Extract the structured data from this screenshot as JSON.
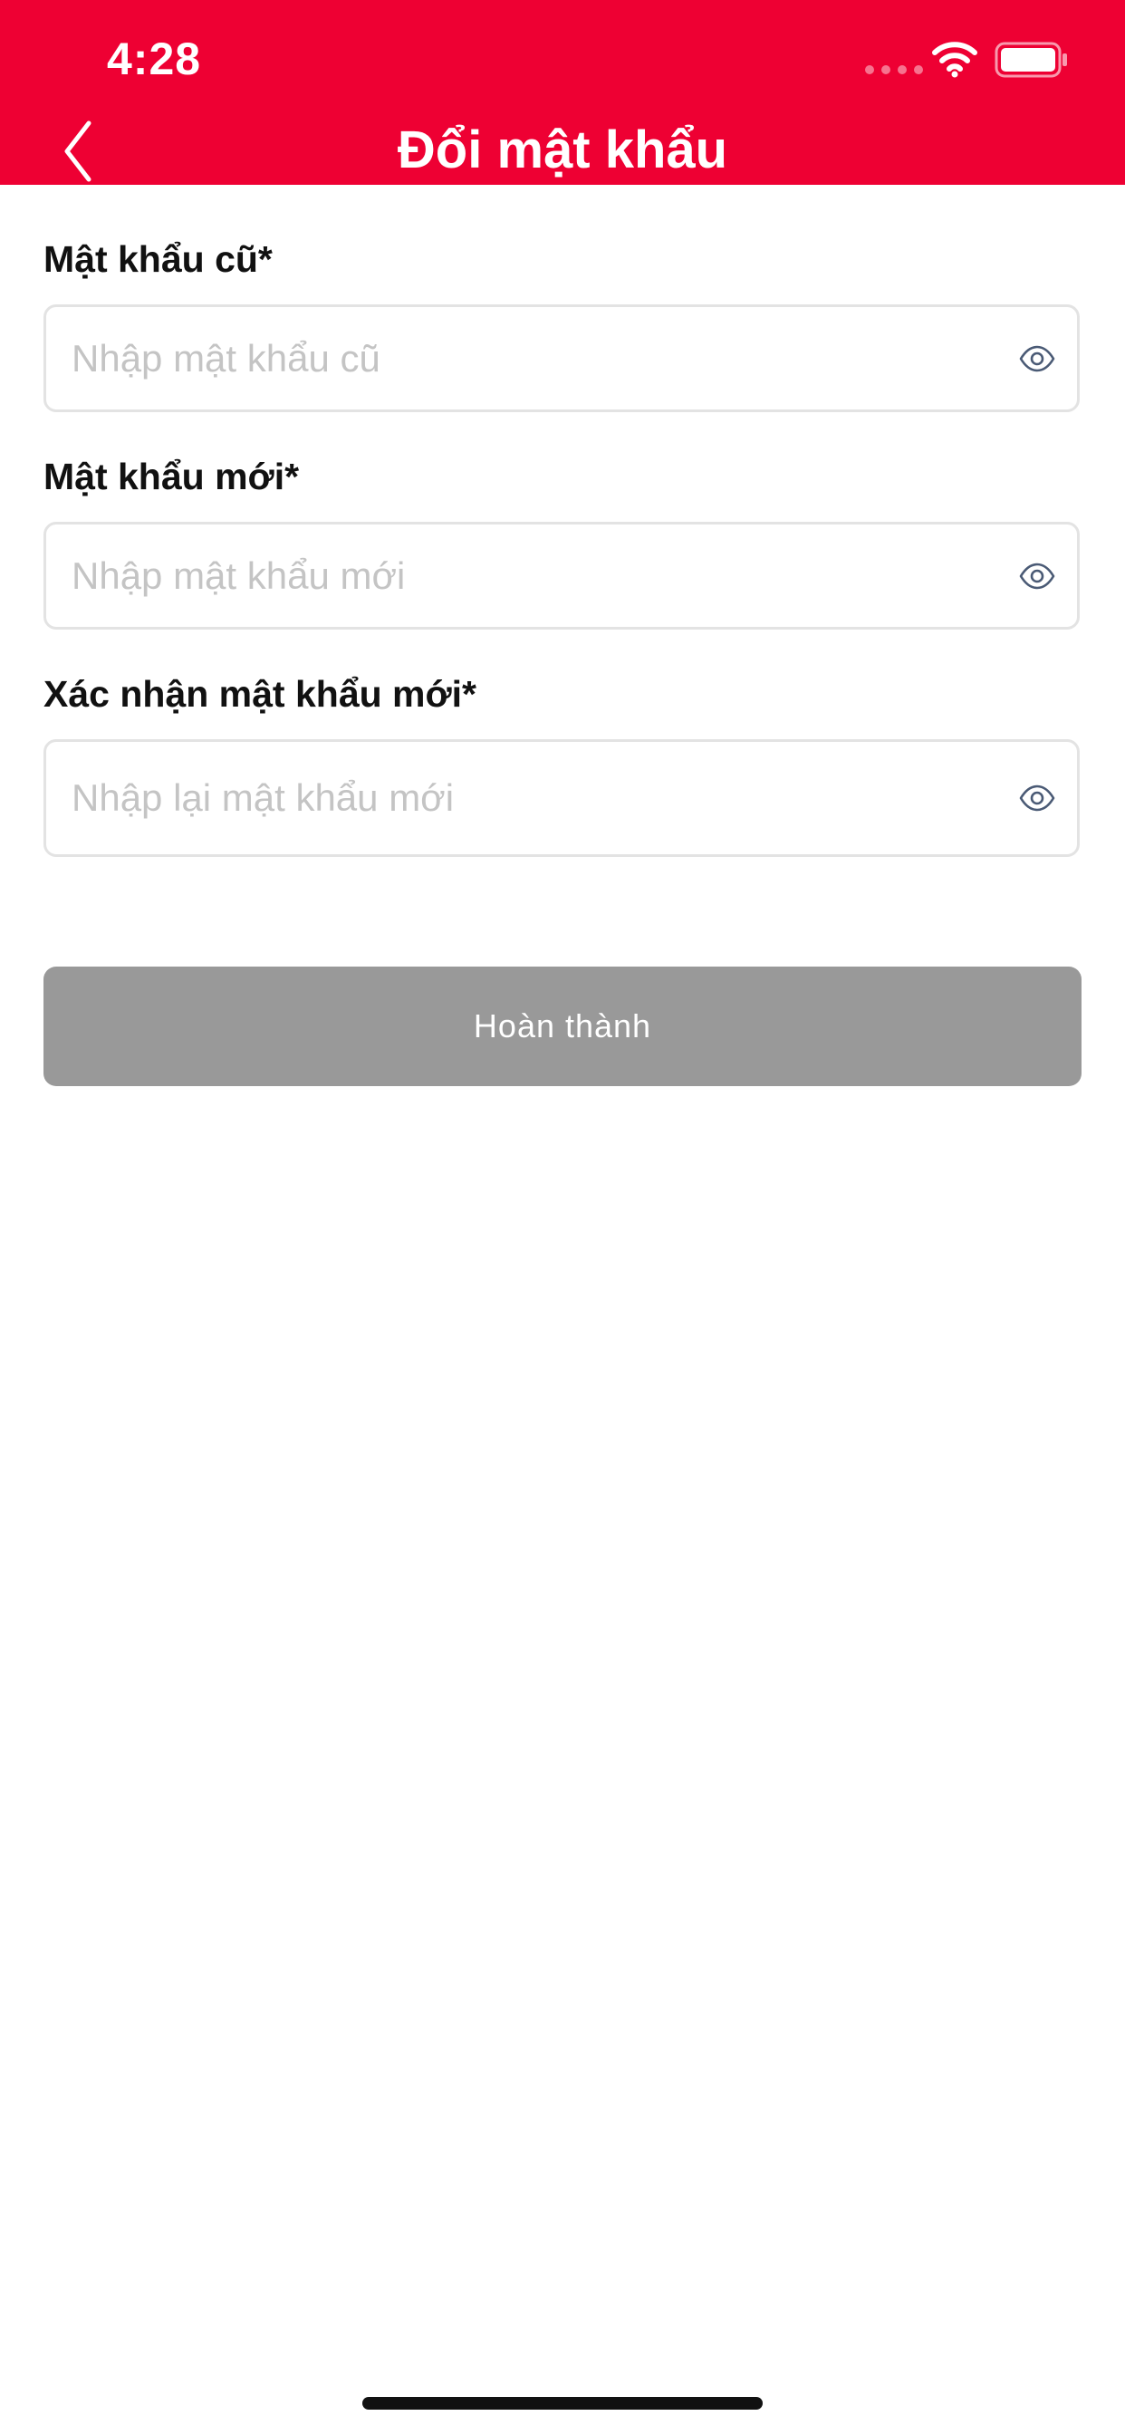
{
  "status_bar": {
    "time": "4:28"
  },
  "header": {
    "title": "Đổi mật khẩu",
    "background_color": "#EE0033"
  },
  "form": {
    "fields": [
      {
        "label": "Mật khẩu cũ*",
        "placeholder": "Nhập mật khẩu cũ",
        "value": ""
      },
      {
        "label": "Mật khẩu mới*",
        "placeholder": "Nhập mật khẩu mới",
        "value": ""
      },
      {
        "label": "Xác nhận mật khẩu mới*",
        "placeholder": "Nhập lại mật khẩu mới",
        "value": ""
      }
    ],
    "submit_label": "Hoàn thành",
    "submit_color": "#999999"
  },
  "icons": {
    "back": "chevron-left-icon",
    "visibility": "eye-icon",
    "wifi": "wifi-icon",
    "battery": "battery-icon"
  }
}
